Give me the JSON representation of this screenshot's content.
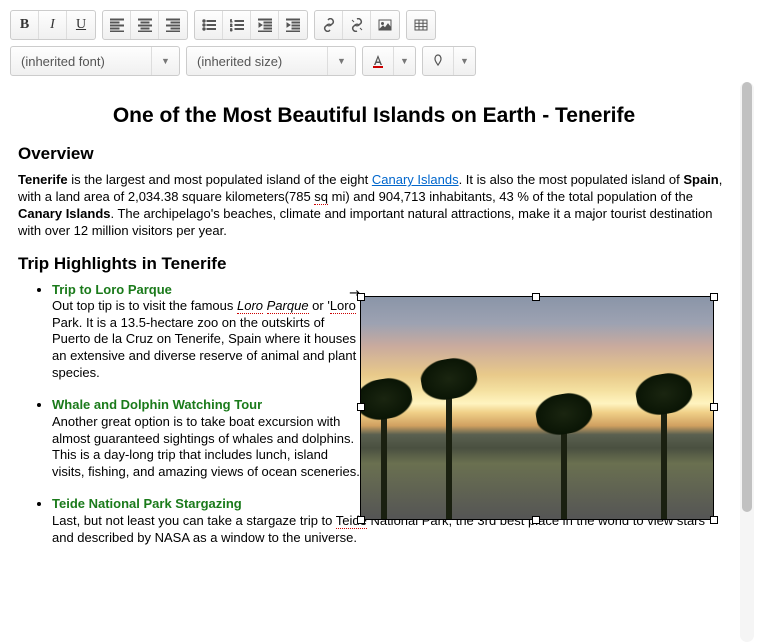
{
  "toolbar": {
    "font_dropdown": "(inherited font)",
    "size_dropdown": "(inherited size)"
  },
  "content": {
    "title": "One of the Most Beautiful Islands on Earth - Tenerife",
    "overview_heading": "Overview",
    "para1": {
      "t1": "Tenerife",
      "t2": " is the largest and most populated island of the eight ",
      "link": "Canary Islands",
      "t3": ". It is also the most populated island of ",
      "t4": "Spain",
      "t5": ", with a land area of 2,034.38 square kilometers(785 ",
      "sq": "sq",
      "t6": " mi) and 904,713 inhabitants, 43 % of the total population of the ",
      "t7": "Canary Islands",
      "t8": ". The archipelago's beaches, climate and important natural attractions, make it a major tourist destination with over 12 million visitors per year."
    },
    "highlights_heading": "Trip Highlights in Tenerife",
    "items": [
      {
        "title": "Trip to Loro Parque",
        "b1": "Out top tip is to visit the famous ",
        "loro": "Loro",
        "space": " ",
        "parque": "Parque",
        "b2": " or '",
        "loro2": "Loro",
        "b3": " Park. It is a 13.5-hectare zoo on the outskirts of Puerto de la Cruz on Tenerife, Spain where it houses an extensive and diverse reserve of animal and plant species."
      },
      {
        "title": "Whale and Dolphin Watching Tour",
        "body": "Another great option is to take boat excursion with almost guaranteed sightings of whales and dolphins. This is a day-long trip that includes lunch, island visits, fishing, and amazing views of ocean sceneries."
      },
      {
        "title": "Teide National Park Stargazing",
        "b1": "Last, but not least you can take a stargaze trip to ",
        "teide": "Teide",
        "b2": " National Park, the 3rd best place in the world to view stars and described by NASA as a window to the universe."
      }
    ]
  }
}
